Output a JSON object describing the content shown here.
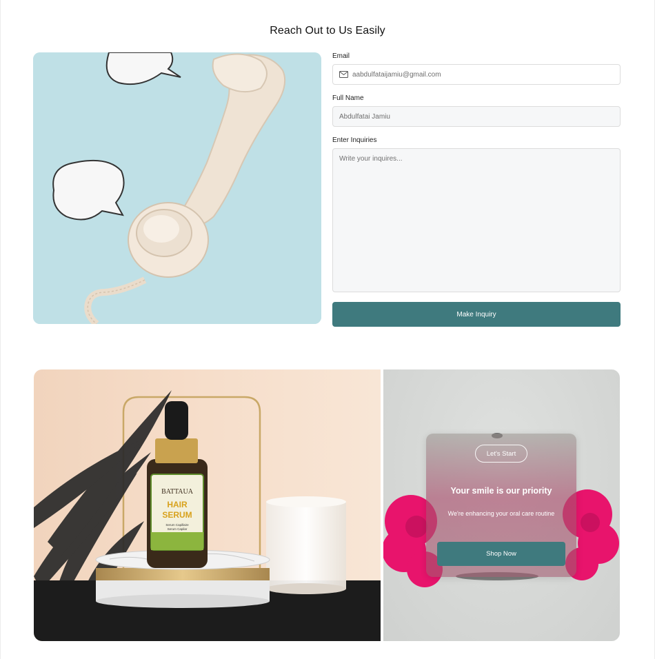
{
  "contact": {
    "title": "Reach Out to Us Easily",
    "email_label": "Email",
    "email_value": "aabdulfataijamiu@gmail.com",
    "name_label": "Full Name",
    "name_value": "Abdulfatai Jamiu",
    "inquiries_label": "Enter Inquiries",
    "inquiries_placeholder": "Write your inquires...",
    "submit_label": "Make Inquiry"
  },
  "product": {
    "brand": "BATTAUA",
    "name_line1": "HAIR",
    "name_line2": "SERUM",
    "sub1": "Serum Capillaire",
    "sub2": "Serum Capilar"
  },
  "promo": {
    "start_label": "Let's Start",
    "headline": "Your smile is our priority",
    "subtext": "We're enhancing your oral care routine",
    "shop_label": "Shop Now"
  },
  "colors": {
    "accent": "#3f7a7e",
    "phone_bg": "#bfe0e6",
    "promo_pink": "#e8146c"
  }
}
